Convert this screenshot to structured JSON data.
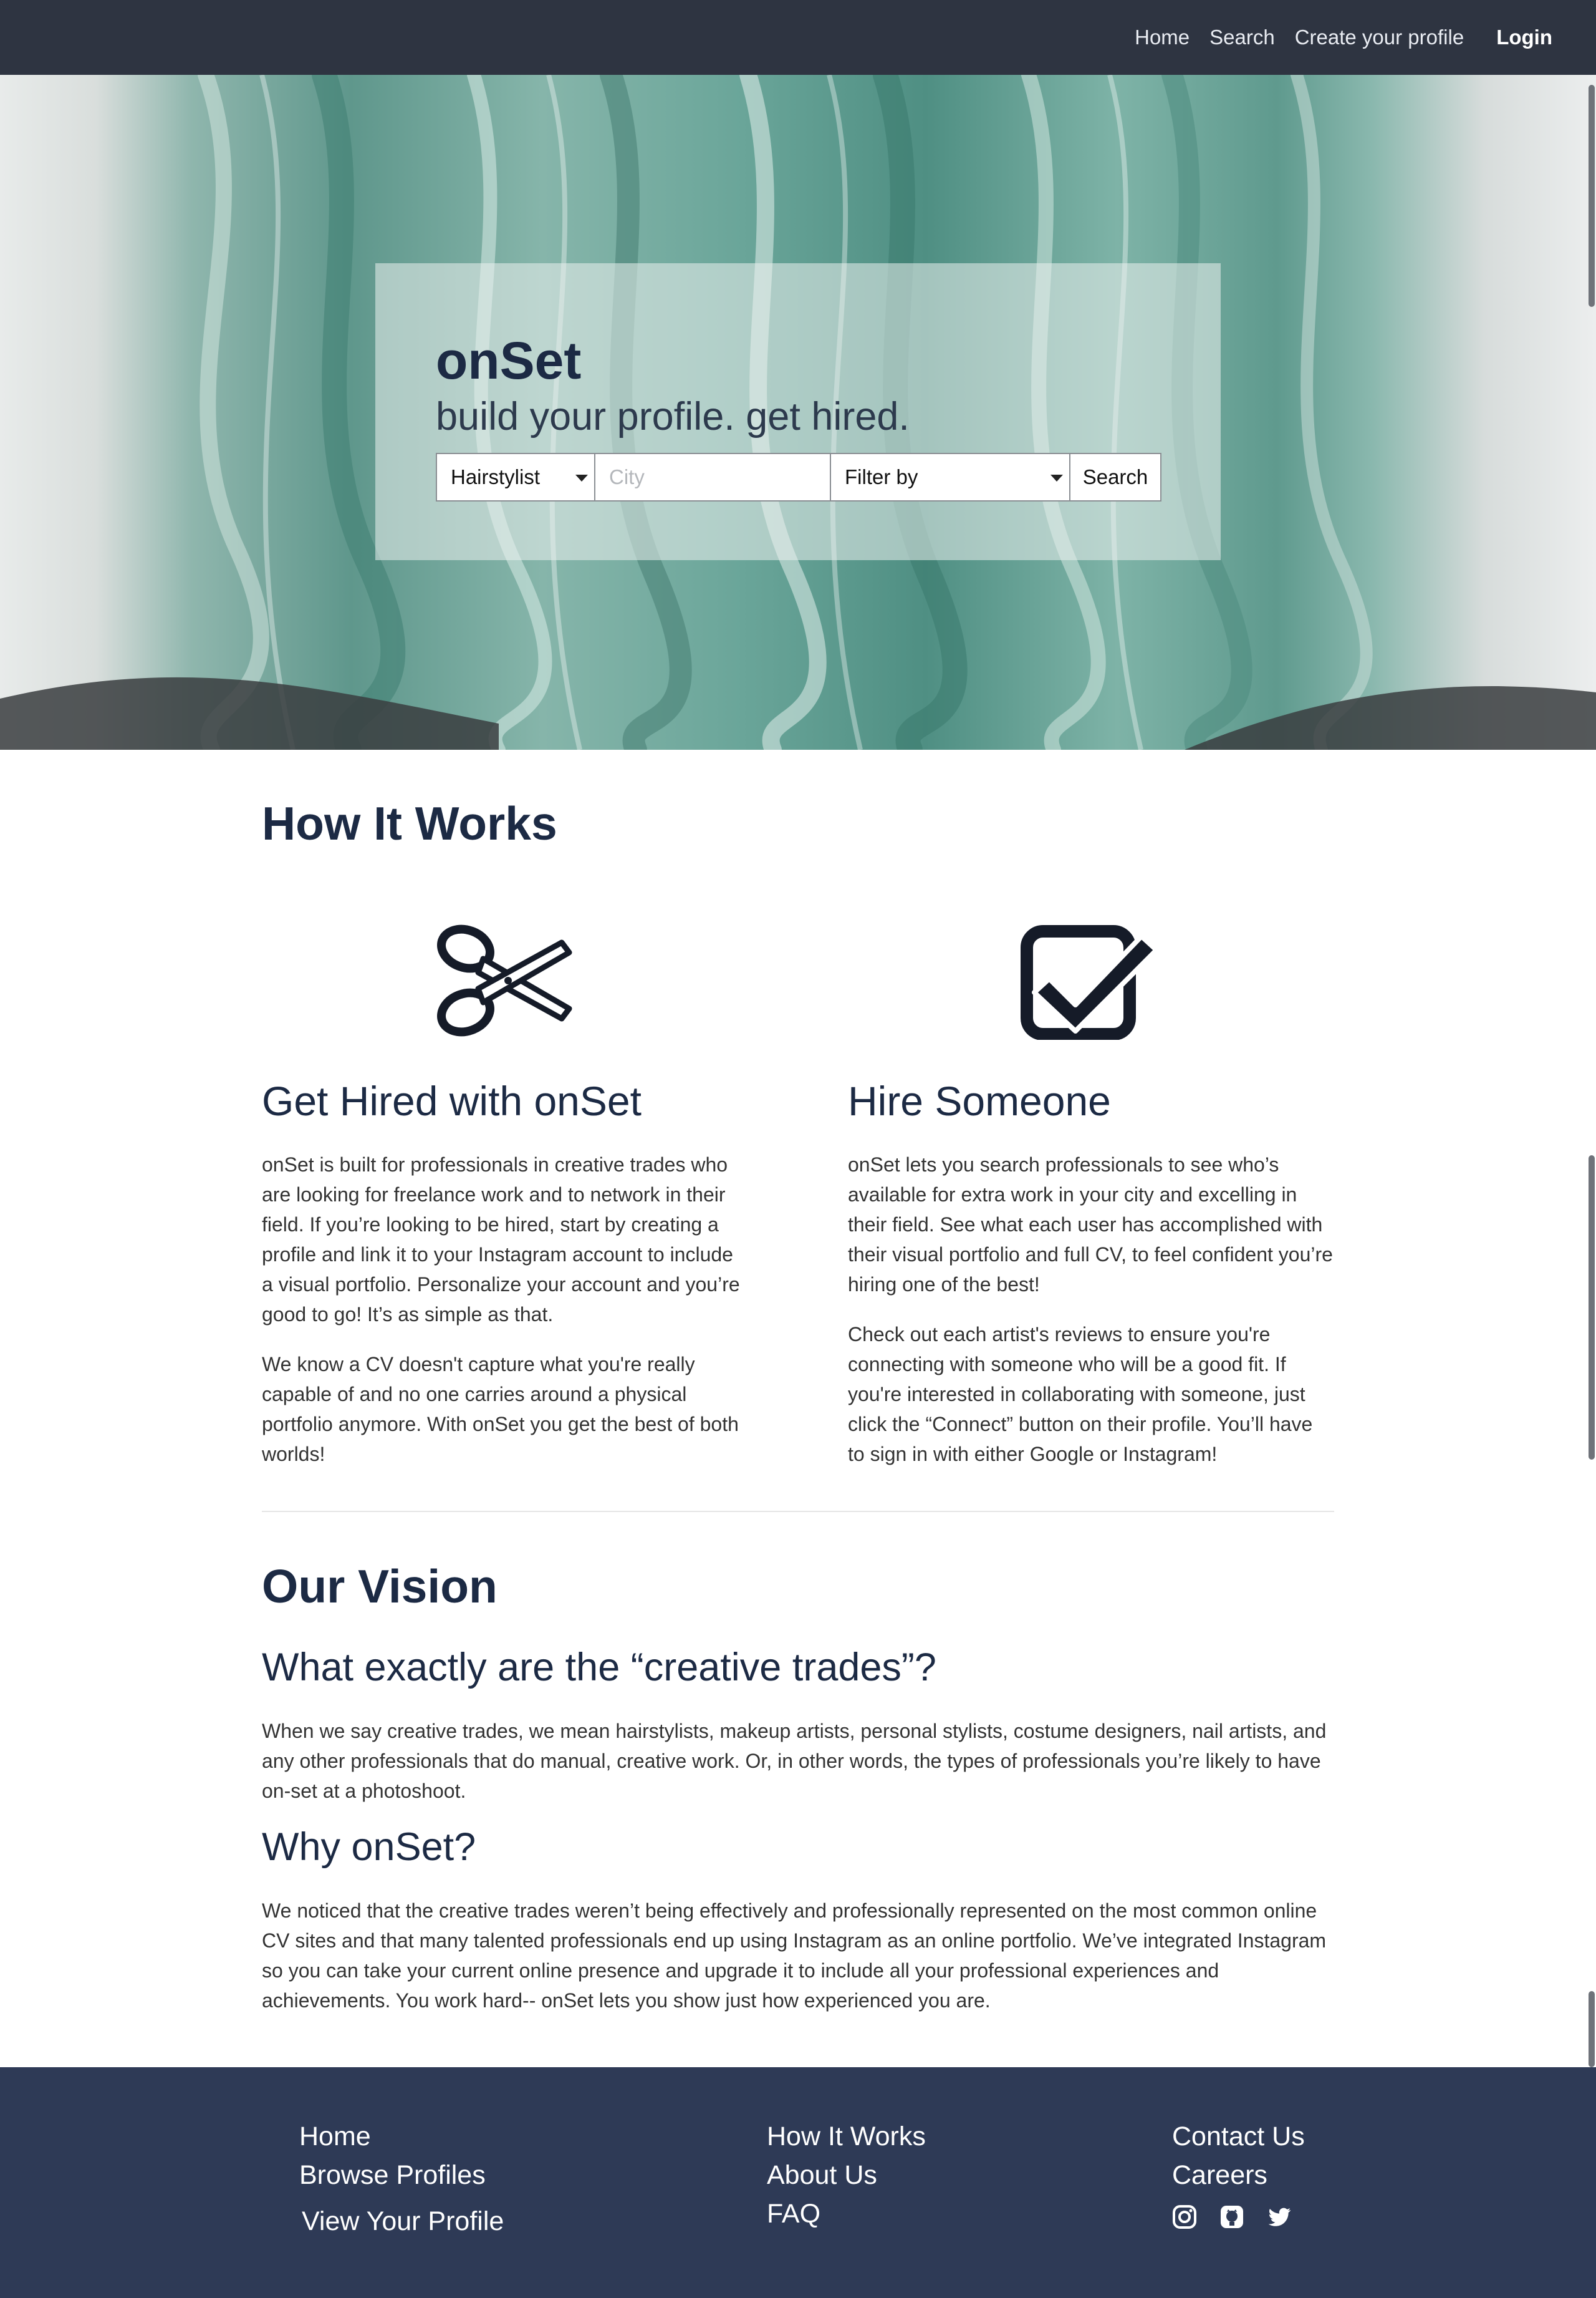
{
  "nav": {
    "links": [
      "Home",
      "Search",
      "Create your profile"
    ],
    "login": "Login"
  },
  "hero": {
    "title": "onSet",
    "subtitle": "build your profile. get hired.",
    "trade_select": "Hairstylist",
    "city_placeholder": "City",
    "filter_select": "Filter by",
    "search_button": "Search"
  },
  "how": {
    "title": "How It Works",
    "left": {
      "icon": "scissors-icon",
      "heading": "Get Hired with onSet",
      "p1": "onSet is built for professionals in creative trades who are looking for freelance work and to network in their field. If you’re looking to be hired, start by creating a profile and link it to your Instagram account to include a visual portfolio. Personalize your account and you’re good to go! It’s as simple as that.",
      "p2": "We know a CV doesn't capture what you're really capable of and no one carries around a physical portfolio anymore. With onSet you get the best of both worlds!"
    },
    "right": {
      "icon": "checkbox-check-icon",
      "heading": "Hire Someone",
      "p1": "onSet lets you search professionals to see who’s available for extra work in your city and excelling in their field. See what each user has accomplished with their visual portfolio and full CV, to feel confident you’re hiring one of the best!",
      "p2": "Check out each artist's reviews to ensure you're connecting with someone who will be a good fit. If you're interested in collaborating with someone, just click the “Connect” button on their profile. You’ll have to sign in with either Google or Instagram!"
    }
  },
  "vision": {
    "title": "Our Vision",
    "q1": "What exactly are the “creative trades”?",
    "a1": "When we say creative trades, we mean hairstylists, makeup artists, personal stylists, costume designers, nail artists, and any other professionals that do manual, creative work. Or, in other words, the types of professionals you’re likely to have on-set at a photoshoot.",
    "q2": "Why onSet?",
    "a2": "We noticed that the creative trades weren’t being effectively and professionally represented on the most common online CV sites and that many talented professionals end up using Instagram as an online portfolio. We’ve integrated Instagram so you can take your current online presence and upgrade it to include all your professional experiences and achievements. You work hard-- onSet lets you show just how experienced you are."
  },
  "footer": {
    "col1": [
      "Home",
      "Browse Profiles",
      "View Your Profile"
    ],
    "col2": [
      "How It Works",
      "About Us",
      "FAQ"
    ],
    "col3": [
      "Contact Us",
      "Careers"
    ],
    "social_icons": [
      "instagram-icon",
      "github-icon",
      "twitter-icon"
    ]
  },
  "colors": {
    "navbar": "#2e3441",
    "footer": "#2e3a56",
    "heading": "#1c2a44"
  }
}
